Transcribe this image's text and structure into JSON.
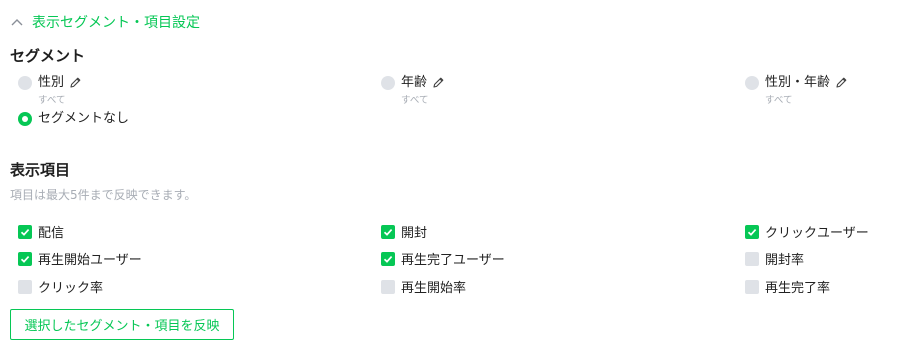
{
  "header": {
    "title": "表示セグメント・項目設定"
  },
  "segment": {
    "title": "セグメント",
    "options": [
      {
        "label": "性別",
        "sub": "すべて",
        "selected": false,
        "editable": true
      },
      {
        "label": "年齢",
        "sub": "すべて",
        "selected": false,
        "editable": true
      },
      {
        "label": "性別・年齢",
        "sub": "すべて",
        "selected": false,
        "editable": true
      },
      {
        "label": "セグメントなし",
        "sub": "",
        "selected": true,
        "editable": false
      }
    ]
  },
  "items": {
    "title": "表示項目",
    "note": "項目は最大5件まで反映できます。",
    "checkboxes": [
      {
        "label": "配信",
        "checked": true
      },
      {
        "label": "開封",
        "checked": true
      },
      {
        "label": "クリックユーザー",
        "checked": true
      },
      {
        "label": "再生開始ユーザー",
        "checked": true
      },
      {
        "label": "再生完了ユーザー",
        "checked": true
      },
      {
        "label": "開封率",
        "checked": false
      },
      {
        "label": "クリック率",
        "checked": false
      },
      {
        "label": "再生開始率",
        "checked": false
      },
      {
        "label": "再生完了率",
        "checked": false
      }
    ]
  },
  "apply_button": {
    "label": "選択したセグメント・項目を反映"
  },
  "colors": {
    "accent": "#06c755",
    "muted": "#a8adb5",
    "inactive": "#dfe2e7"
  }
}
